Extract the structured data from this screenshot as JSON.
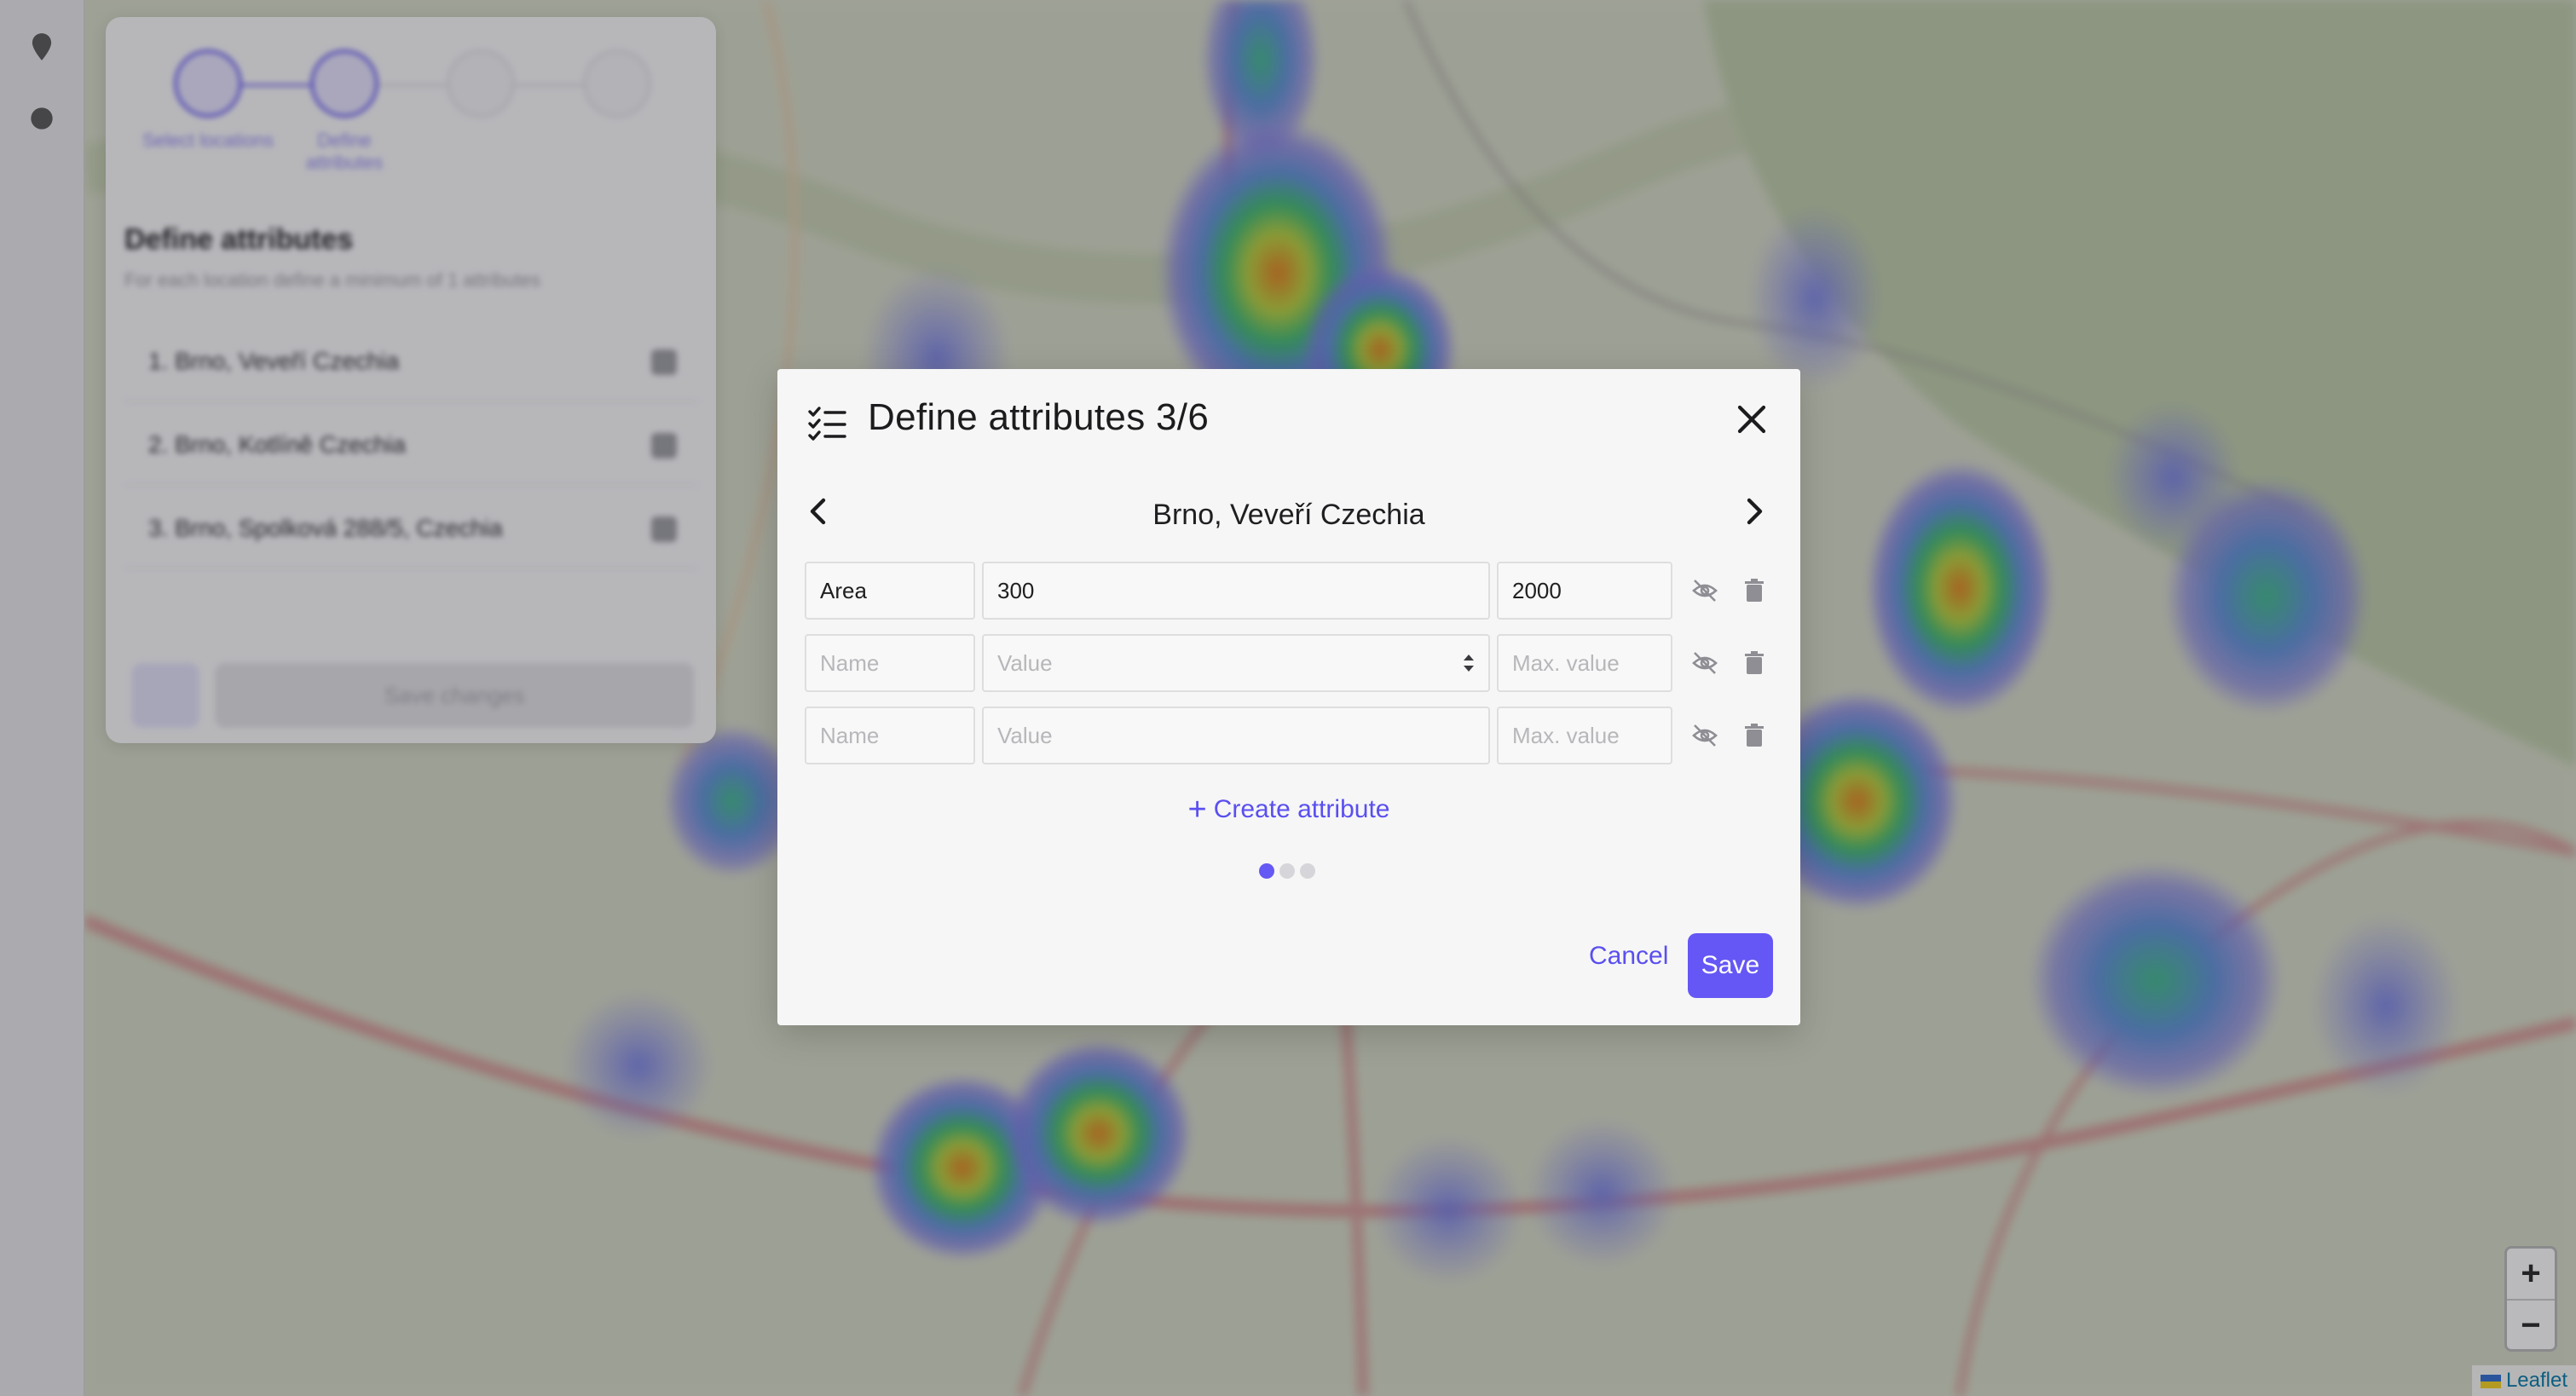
{
  "sidebar": {
    "steps": [
      {
        "label": "Select locations",
        "state": "done"
      },
      {
        "label": "Define attributes",
        "state": "active"
      },
      {
        "label": "",
        "state": "inactive"
      },
      {
        "label": "",
        "state": "inactive"
      }
    ],
    "title": "Define attributes",
    "subtitle": "For each location define a minimum of 1 attributes",
    "locations": [
      "1. Brno, Veveří Czechia",
      "2. Brno, Kotlíně Czechia",
      "3. Brno, Spolková 288/5, Czechia"
    ],
    "save_label": "Save changes"
  },
  "map": {
    "zoom_in": "+",
    "zoom_out": "−",
    "attribution": "Leaflet"
  },
  "modal": {
    "title": "Define attributes 3/6",
    "location": "Brno, Veveří Czechia",
    "attributes": [
      {
        "name": "Area",
        "value": "300",
        "max": "2000"
      },
      {
        "name": "",
        "value": "",
        "max": ""
      },
      {
        "name": "",
        "value": "",
        "max": ""
      }
    ],
    "placeholders": {
      "name": "Name",
      "value": "Value",
      "max": "Max. value"
    },
    "create_label": "Create attribute",
    "pagination": {
      "total": 3,
      "current": 1
    },
    "cancel_label": "Cancel",
    "save_label": "Save"
  },
  "colors": {
    "accent": "#6557f5",
    "link": "#5a4ff0"
  },
  "icons": [
    "checklist-icon",
    "close-icon",
    "chevron-left-icon",
    "chevron-right-icon",
    "eye-off-icon",
    "trash-icon",
    "plus-icon",
    "map-pin-icon"
  ]
}
